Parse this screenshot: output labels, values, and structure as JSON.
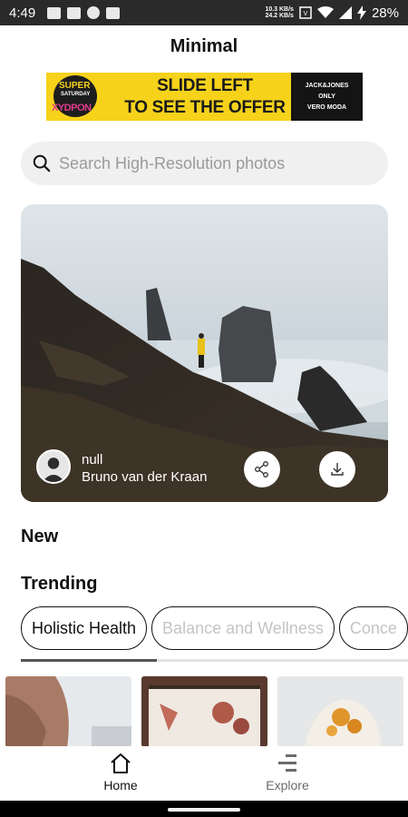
{
  "status_bar": {
    "time": "4:49",
    "net_speed_up": "10.3 KB/s",
    "net_speed_down": "24.2 KB/s",
    "battery": "28%",
    "icons": [
      "image-icon",
      "youtube-icon",
      "spotify-icon",
      "keyboard-icon",
      "volte-icon",
      "wifi-icon",
      "signal-icon",
      "charging-icon"
    ]
  },
  "header": {
    "title": "Minimal"
  },
  "ad": {
    "logo_line1": "SUPER",
    "logo_line2": "SATURDAY",
    "logo_line3": "XYDPON",
    "headline_line1": "SLIDE LEFT",
    "headline_line2": "TO SEE THE OFFER",
    "brand_line1": "JACK&JONES",
    "brand_line2": "ONLY",
    "brand_line3": "VERO MODA"
  },
  "search": {
    "placeholder": "Search High-Resolution photos"
  },
  "featured": {
    "username": "null",
    "author": "Bruno van der Kraan",
    "share_icon": "share-icon",
    "download_icon": "download-icon"
  },
  "sections": {
    "new": "New",
    "trending": "Trending"
  },
  "chips": [
    {
      "label": "Holistic Health",
      "active": true
    },
    {
      "label": "Balance and Wellness",
      "active": false
    },
    {
      "label": "Conce",
      "active": false
    }
  ],
  "bottom_nav": [
    {
      "label": "Home",
      "icon": "home-icon",
      "active": true
    },
    {
      "label": "Explore",
      "icon": "explore-icon",
      "active": false
    }
  ],
  "colors": {
    "accent_text": "#111111",
    "inactive_text": "#9a9a9a",
    "ad_yellow": "#f6d21a"
  }
}
